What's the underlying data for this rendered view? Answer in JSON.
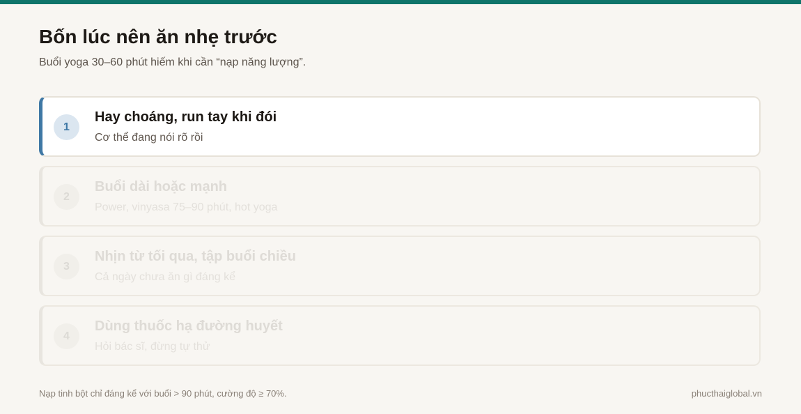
{
  "header": {
    "title": "Bốn lúc nên ăn nhẹ trước",
    "subtitle": "Buổi yoga 30–60 phút hiếm khi cần “nạp năng lượng”."
  },
  "items": [
    {
      "number": "1",
      "title": "Hay choáng, run tay khi đói",
      "subtitle": "Cơ thể đang nói rõ rồi",
      "active": true
    },
    {
      "number": "2",
      "title": "Buổi dài hoặc mạnh",
      "subtitle": "Power, vinyasa 75–90 phút, hot yoga",
      "active": false
    },
    {
      "number": "3",
      "title": "Nhịn từ tối qua, tập buổi chiều",
      "subtitle": "Cả ngày chưa ăn gì đáng kể",
      "active": false
    },
    {
      "number": "4",
      "title": "Dùng thuốc hạ đường huyết",
      "subtitle": "Hỏi bác sĩ, đừng tự thử",
      "active": false
    }
  ],
  "footer": {
    "note": "Nạp tinh bột chỉ đáng kể với buổi > 90 phút, cường độ ≥ 70%.",
    "site": "phucthaiglobal.vn"
  },
  "colors": {
    "accent_bar": "#0f756b",
    "active_border": "#3f78a5"
  }
}
